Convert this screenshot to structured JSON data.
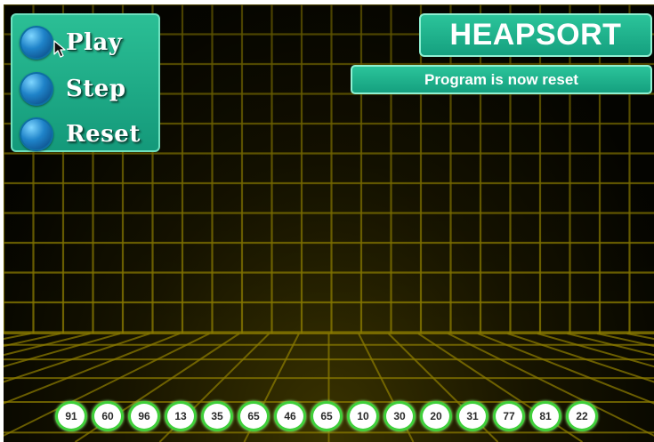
{
  "title": "HEAPSORT",
  "status": "Program is now reset",
  "controls": {
    "play_label": "Play",
    "step_label": "Step",
    "reset_label": "Reset"
  },
  "items": [
    "91",
    "60",
    "96",
    "13",
    "35",
    "65",
    "46",
    "65",
    "10",
    "30",
    "20",
    "31",
    "77",
    "81",
    "22"
  ],
  "colors": {
    "panel": "#1aa886",
    "grid_line": "#8a7a00",
    "item_border": "#3fcf3a",
    "button_ball": "#1f83c9"
  },
  "icons": {
    "cursor": "mouse-pointer-icon"
  }
}
